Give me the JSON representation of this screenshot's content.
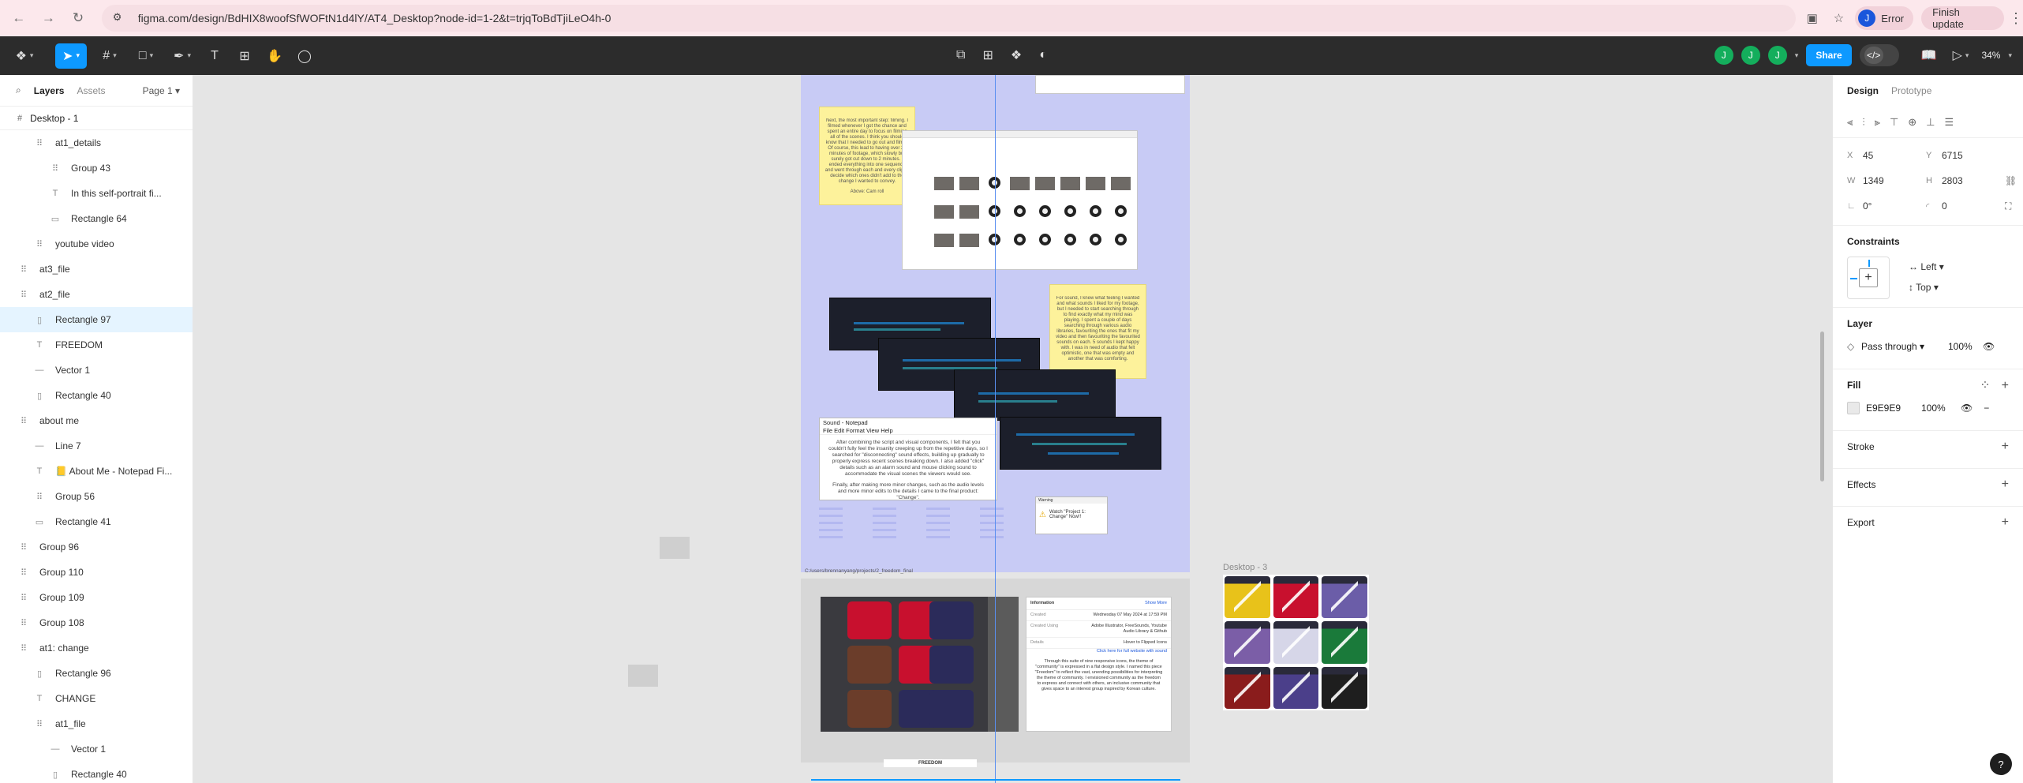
{
  "browser": {
    "url": "figma.com/design/BdHIX8woofSfWOFtN1d4lY/AT4_Desktop?node-id=1-2&t=trjqToBdTjiLeO4h-0",
    "error_label": "Error",
    "finish_update_label": "Finish update",
    "profile_initial": "J"
  },
  "toolbar": {
    "share_label": "Share",
    "zoom": "34%",
    "users": [
      "J",
      "J",
      "J"
    ]
  },
  "left_panel": {
    "tabs": [
      "Layers",
      "Assets"
    ],
    "page_selector": "Page 1",
    "page_name": "Desktop - 1",
    "layers": [
      {
        "name": "at1_details",
        "icon": "⠿",
        "indent": 2,
        "selected": false
      },
      {
        "name": "Group 43",
        "icon": "⠿",
        "indent": 3,
        "selected": false
      },
      {
        "name": "In this self-portrait fi...",
        "icon": "T",
        "indent": 3,
        "selected": false
      },
      {
        "name": "Rectangle 64",
        "icon": "▭",
        "indent": 3,
        "selected": false
      },
      {
        "name": "youtube video",
        "icon": "⠿",
        "indent": 2,
        "selected": false
      },
      {
        "name": "at3_file",
        "icon": "⠿",
        "indent": 1,
        "selected": false
      },
      {
        "name": "at2_file",
        "icon": "⠿",
        "indent": 1,
        "selected": false
      },
      {
        "name": "Rectangle 97",
        "icon": "▯",
        "indent": 2,
        "selected": true
      },
      {
        "name": "FREEDOM",
        "icon": "T",
        "indent": 2,
        "selected": false
      },
      {
        "name": "Vector 1",
        "icon": "—",
        "indent": 2,
        "selected": false
      },
      {
        "name": "Rectangle 40",
        "icon": "▯",
        "indent": 2,
        "selected": false
      },
      {
        "name": "about me",
        "icon": "⠿",
        "indent": 1,
        "selected": false
      },
      {
        "name": "Line 7",
        "icon": "—",
        "indent": 2,
        "selected": false
      },
      {
        "name": "📒 About Me - Notepad Fi...",
        "icon": "T",
        "indent": 2,
        "selected": false
      },
      {
        "name": "Group 56",
        "icon": "⠿",
        "indent": 2,
        "selected": false
      },
      {
        "name": "Rectangle 41",
        "icon": "▭",
        "indent": 2,
        "selected": false
      },
      {
        "name": "Group 96",
        "icon": "⠿",
        "indent": 1,
        "selected": false
      },
      {
        "name": "Group 110",
        "icon": "⠿",
        "indent": 1,
        "selected": false
      },
      {
        "name": "Group 109",
        "icon": "⠿",
        "indent": 1,
        "selected": false
      },
      {
        "name": "Group 108",
        "icon": "⠿",
        "indent": 1,
        "selected": false
      },
      {
        "name": "at1: change",
        "icon": "⠿",
        "indent": 1,
        "selected": false
      },
      {
        "name": "Rectangle 96",
        "icon": "▯",
        "indent": 2,
        "selected": false
      },
      {
        "name": "CHANGE",
        "icon": "T",
        "indent": 2,
        "selected": false
      },
      {
        "name": "at1_file",
        "icon": "⠿",
        "indent": 2,
        "selected": false
      },
      {
        "name": "Vector 1",
        "icon": "—",
        "indent": 3,
        "selected": false
      },
      {
        "name": "Rectangle 40",
        "icon": "▯",
        "indent": 3,
        "selected": false
      }
    ]
  },
  "canvas": {
    "sticky1": "Next, the most important step: filming. I filmed whenever I got the chance and spent an entire day to focus on filming all of the scenes. I think you should know that I needed to go out and film it. Of course, this lead to having over 20 minutes of footage, which slowly but surely got cut down to 2 minutes. I ended everything into one sequence and went through each and every clip to decide which ones didn't add to the change I wanted to convey.",
    "sticky1_foot": "Above: Cam roll",
    "sticky2": "For sound, I knew what feeling I wanted and what sounds I liked for my footage, but I needed to start searching through to find exactly what my mind was playing. I spent a couple of days searching through various audio libraries, favouriting the ones that fit my video and then favouriting the favourited sounds on each. 5 sounds I kept happy with. I was in need of audio that felt optimistic, one that was empty and another that was comforting.",
    "notepad_title": "Sound - Notepad",
    "notepad_menu": "File  Edit  Format  View  Help",
    "notepad_body": "After combining the script and visual components, I felt that you couldn't fully feel the insanity creeping up from the repetitive days, so I searched for \"disconnecting\" sound effects, building up gradually to properly express recent scenes breaking down. I also added \"click\" details such as an alarm sound and mouse clicking sound to accommodate the visual scenes the viewers would see.",
    "notepad_body2": "Finally, after making more minor changes, such as the audio levels and more minor edits to the details I came to the final product: \"Change\".",
    "warning_title": "Warning",
    "warning_text": "Watch \"Project 1: Change\" Now!!",
    "frame2_path": "C:/users/brennanyang/projects/2_freedom_final",
    "info_title": "Information",
    "info_link": "Show More",
    "info_rows": [
      {
        "k": "Created",
        "v": "Wednesday 07 May 2024 at 17:59 PM"
      },
      {
        "k": "Created Using",
        "v": "Adobe Illustrator, FreeSounds, Youtube Audio Library & Github"
      },
      {
        "k": "Details",
        "v": "Hover to Flipped Icons"
      }
    ],
    "info_link2": "Click here for full website with sound",
    "info_body": "Through this suite of nine responsive icons, the theme of \"community\" is expressed in a flat design style. I named this piece \"Freedom\" to reflect the vast, unending possibilities for interpreting the theme of community. I envisioned community as the freedom to express and connect with others, an inclusive community that gives space to an interest group inspired by Korean culture.",
    "freedom_tab": "FREEDOM",
    "desktop3_label": "Desktop - 3"
  },
  "right_panel": {
    "tabs": [
      "Design",
      "Prototype"
    ],
    "x": "45",
    "y": "6715",
    "w": "1349",
    "h": "2803",
    "rotation": "0°",
    "radius": "0",
    "constraints_label": "Constraints",
    "constraint_h": "Left",
    "constraint_v": "Top",
    "layer_label": "Layer",
    "blend": "Pass through",
    "layer_opacity": "100%",
    "fill_label": "Fill",
    "fill_hex": "E9E9E9",
    "fill_opacity": "100%",
    "fill_color": "#e9e9e9",
    "stroke_label": "Stroke",
    "effects_label": "Effects",
    "export_label": "Export"
  },
  "colors": {
    "accent": "#0d99ff",
    "frame_bg": "#c8cbf5",
    "kimonos": [
      "#e8c21a",
      "#c8102e",
      "#6b5da8",
      "#7b5ea7",
      "#d6d6e8",
      "#1a7a3a",
      "#8a1c1c",
      "#4b3f8a",
      "#1e1e1e"
    ]
  }
}
